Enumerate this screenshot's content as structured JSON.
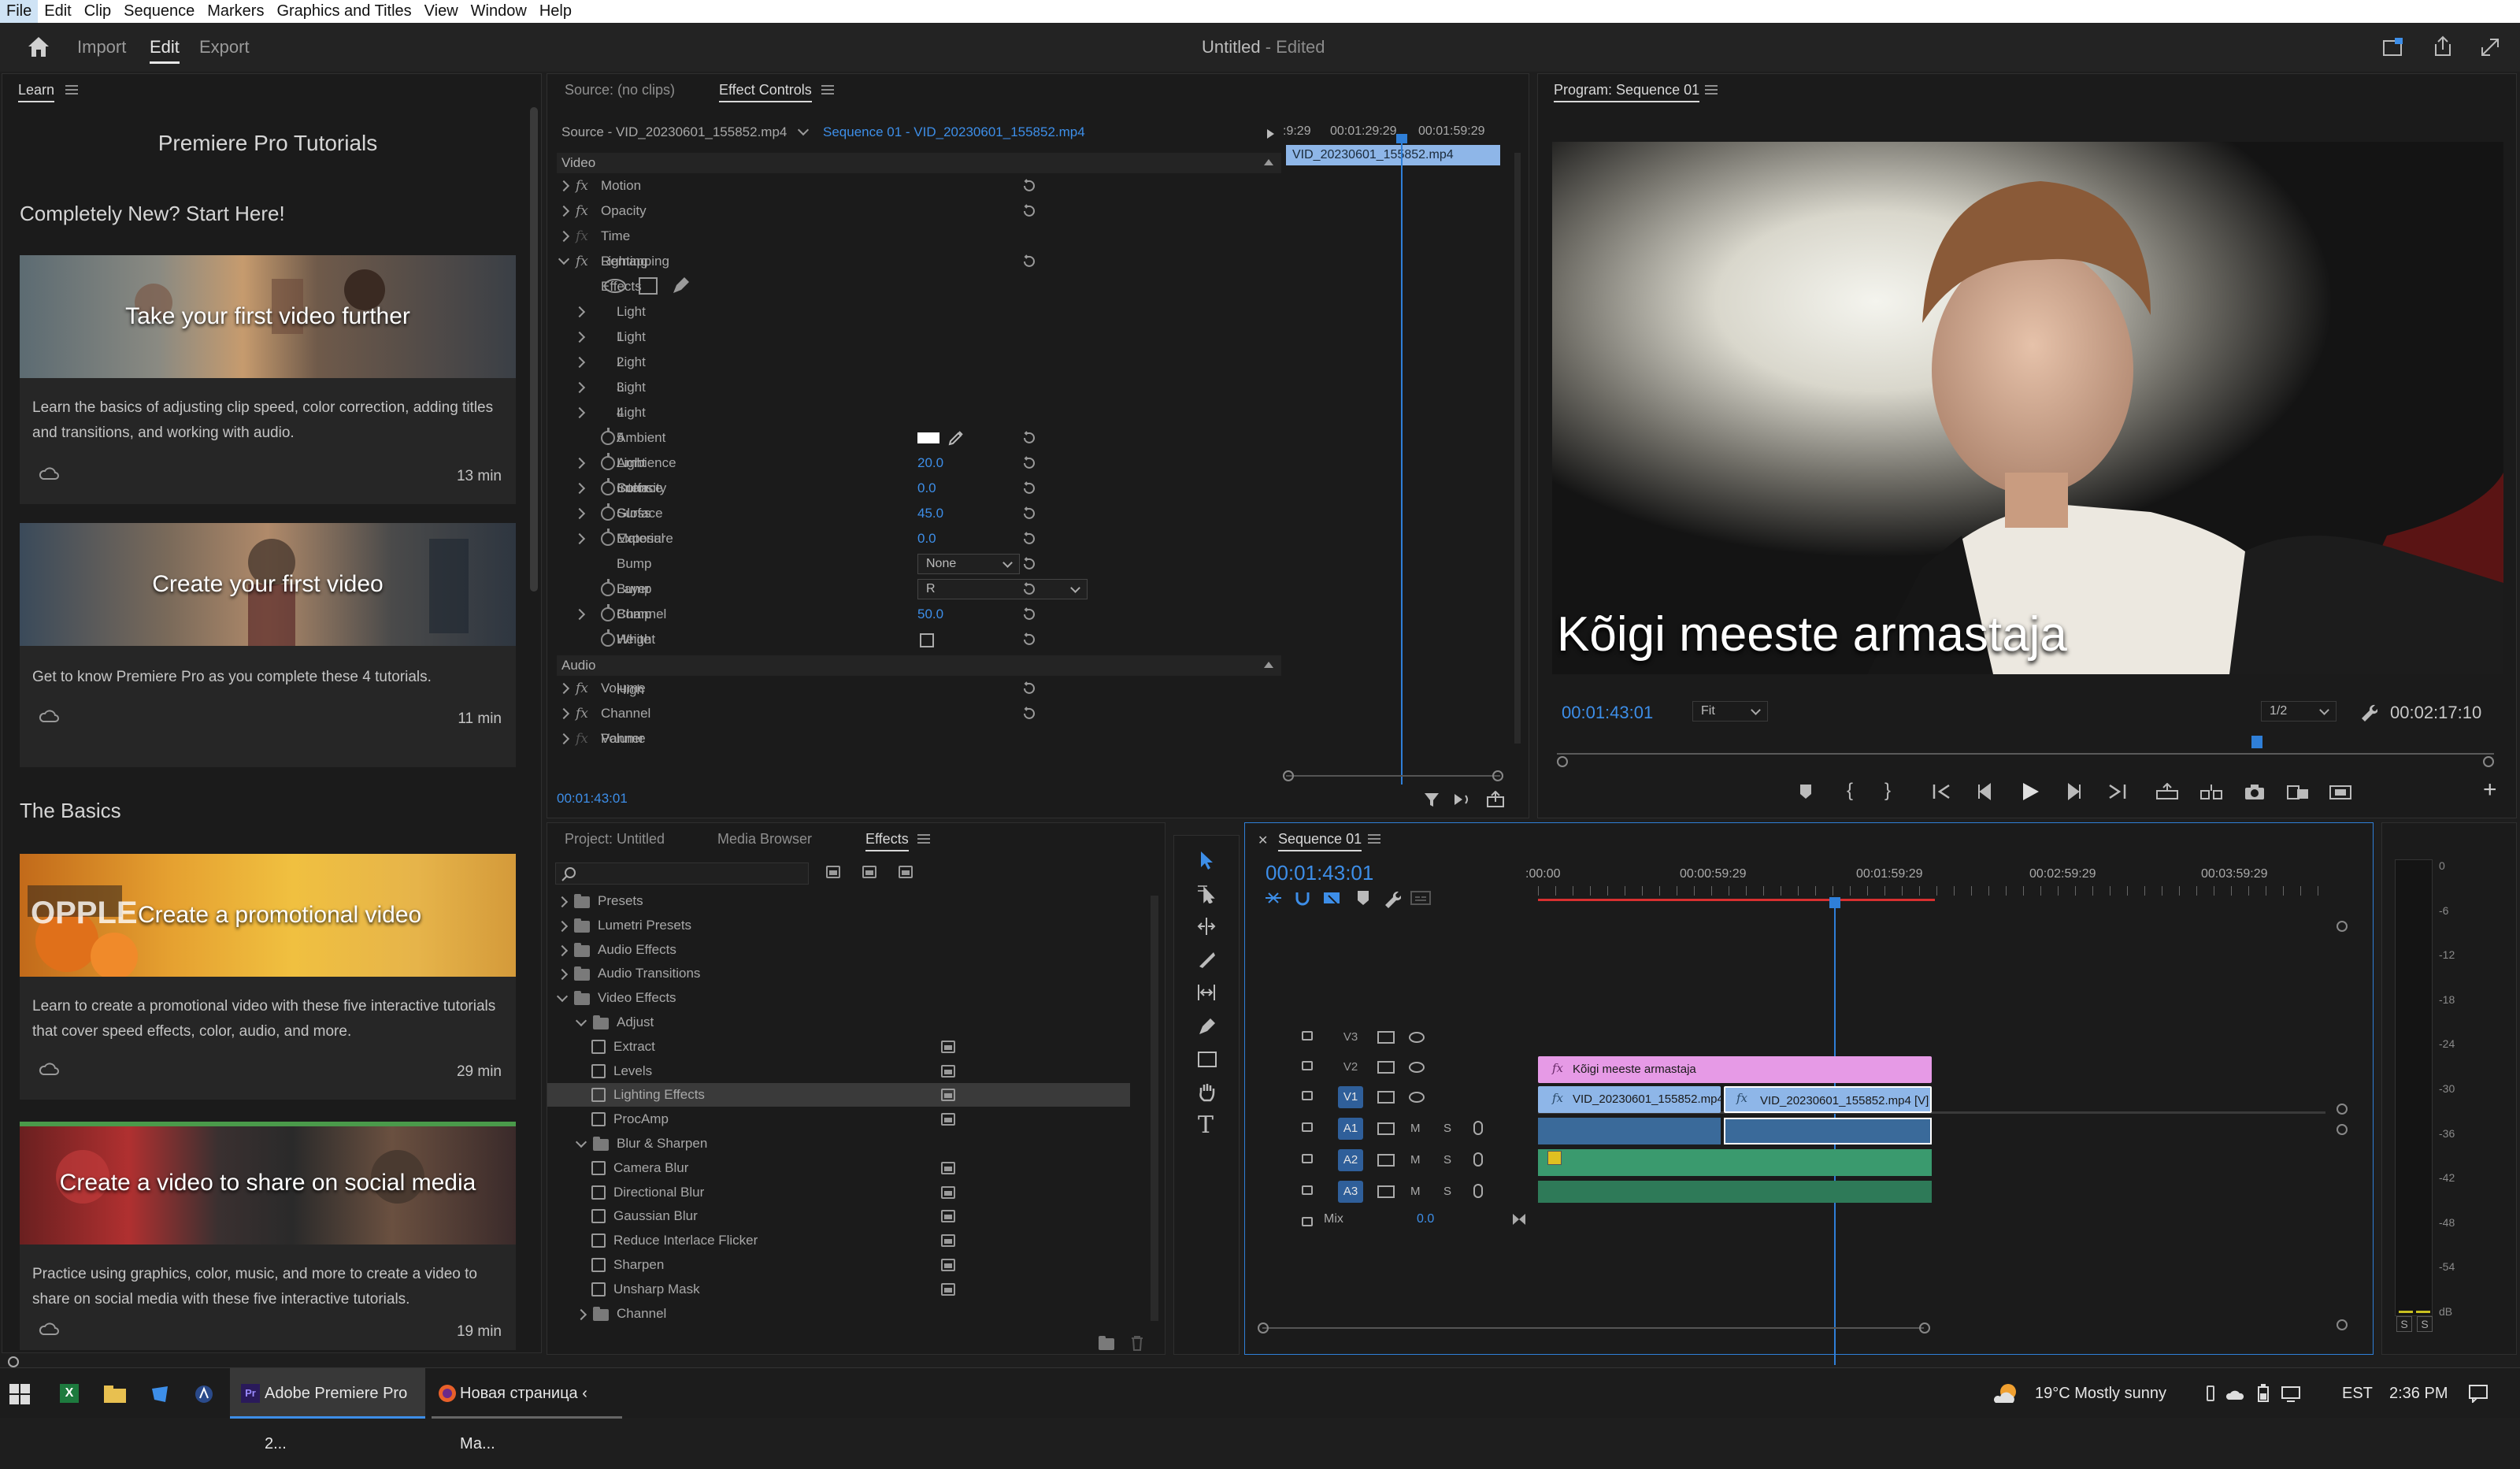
{
  "menubar": [
    "File",
    "Edit",
    "Clip",
    "Sequence",
    "Markers",
    "Graphics and Titles",
    "View",
    "Window",
    "Help"
  ],
  "header": {
    "tabs": [
      "Import",
      "Edit",
      "Export"
    ],
    "active_tab": "Edit",
    "doc_title": "Untitled",
    "doc_status": " - Edited"
  },
  "learn": {
    "tab": "Learn",
    "heading": "Premiere Pro Tutorials",
    "section1": "Completely New? Start Here!",
    "section2": "The Basics",
    "cards": [
      {
        "title": "Take your first video further",
        "desc": "Learn the basics of adjusting clip speed, color correction, adding titles and transitions, and working with audio.",
        "duration": "13 min"
      },
      {
        "title": "Create your first video",
        "desc": "Get to know Premiere Pro as you complete these 4 tutorials.",
        "duration": "11 min"
      },
      {
        "title": "Create a promotional video",
        "desc": "Learn to create a promotional video with these five interactive tutorials that cover speed effects, color, audio, and more.",
        "duration": "29 min"
      },
      {
        "title": "Create a video to share on social media",
        "desc": "Practice using graphics, color, music, and more to create a video to share on social media with these five interactive tutorials.",
        "duration": "19 min"
      }
    ]
  },
  "source_panel": {
    "tabs": [
      "Source: (no clips)",
      "Effect Controls"
    ],
    "active_tab": "Effect Controls",
    "source_clip": "Source - VID_20230601_155852.mp4",
    "sequence_clip": "Sequence 01 - VID_20230601_155852.mp4",
    "ruler": [
      ":9:29",
      "00:01:29:29",
      "00:01:59:29"
    ],
    "clip_bar": "VID_20230601_155852.mp4",
    "timecode": "00:01:43:01",
    "video_header": "Video",
    "audio_header": "Audio",
    "video_effects": [
      "Motion",
      "Opacity",
      "Time Remapping",
      "Lighting Effects"
    ],
    "lights": [
      "Light 1",
      "Light 2",
      "Light 3",
      "Light 4",
      "Light 5"
    ],
    "params": [
      {
        "name": "Ambient Light Color",
        "value": ""
      },
      {
        "name": "Ambience Intensity",
        "value": "20.0"
      },
      {
        "name": "Surface Gloss",
        "value": "0.0"
      },
      {
        "name": "Surface Material",
        "value": "45.0"
      },
      {
        "name": "Exposure",
        "value": "0.0"
      },
      {
        "name": "Bump Layer",
        "value": "None"
      },
      {
        "name": "Bump Channel",
        "value": "R"
      },
      {
        "name": "Bump Height",
        "value": "50.0"
      },
      {
        "name": "White Is High",
        "value": ""
      }
    ],
    "audio_effects": [
      "Volume",
      "Channel Volume",
      "Panner"
    ]
  },
  "program": {
    "title": "Program: Sequence 01",
    "subtitle": "Kõigi meeste armastaja",
    "timecode": "00:01:43:01",
    "fit": "Fit",
    "resolution": "1/2",
    "duration": "00:02:17:10",
    "playhead_fraction": 0.75
  },
  "project_panel": {
    "tabs": [
      "Project: Untitled",
      "Media Browser",
      "Effects"
    ],
    "active_tab": "Effects",
    "tree": [
      {
        "label": "Presets",
        "level": 0,
        "type": "folder",
        "open": false
      },
      {
        "label": "Lumetri Presets",
        "level": 0,
        "type": "folder",
        "open": false
      },
      {
        "label": "Audio Effects",
        "level": 0,
        "type": "folder",
        "open": false
      },
      {
        "label": "Audio Transitions",
        "level": 0,
        "type": "folder",
        "open": false
      },
      {
        "label": "Video Effects",
        "level": 0,
        "type": "folder",
        "open": true
      },
      {
        "label": "Adjust",
        "level": 1,
        "type": "folder",
        "open": true
      },
      {
        "label": "Extract",
        "level": 2,
        "type": "effect"
      },
      {
        "label": "Levels",
        "level": 2,
        "type": "effect"
      },
      {
        "label": "Lighting Effects",
        "level": 2,
        "type": "effect",
        "selected": true
      },
      {
        "label": "ProcAmp",
        "level": 2,
        "type": "effect"
      },
      {
        "label": "Blur & Sharpen",
        "level": 1,
        "type": "folder",
        "open": true
      },
      {
        "label": "Camera Blur",
        "level": 2,
        "type": "effect"
      },
      {
        "label": "Directional Blur",
        "level": 2,
        "type": "effect"
      },
      {
        "label": "Gaussian Blur",
        "level": 2,
        "type": "effect"
      },
      {
        "label": "Reduce Interlace Flicker",
        "level": 2,
        "type": "effect"
      },
      {
        "label": "Sharpen",
        "level": 2,
        "type": "effect"
      },
      {
        "label": "Unsharp Mask",
        "level": 2,
        "type": "effect"
      },
      {
        "label": "Channel",
        "level": 1,
        "type": "folder",
        "open": false
      }
    ]
  },
  "timeline": {
    "tab": "Sequence 01",
    "timecode": "00:01:43:01",
    "ruler": [
      ":00:00",
      "00:00:59:29",
      "00:01:59:29",
      "00:02:59:29",
      "00:03:59:29"
    ],
    "video_tracks": [
      "V3",
      "V2",
      "V1"
    ],
    "audio_tracks": [
      "A1",
      "A2",
      "A3"
    ],
    "track_buttons": {
      "mute": "M",
      "solo": "S"
    },
    "mix_label": "Mix",
    "mix_value": "0.0",
    "title_clip": "Kõigi meeste armastaja",
    "video_clip_1": "VID_20230601_155852.mp4",
    "video_clip_2": "VID_20230601_155852.mp4 [V]"
  },
  "meter": {
    "scale": [
      "0",
      "-6",
      "-12",
      "-18",
      "-24",
      "-30",
      "-36",
      "-42",
      "-48",
      "-54",
      "dB"
    ],
    "solo": [
      "S",
      "S"
    ]
  },
  "taskbar": {
    "items": [
      "Adobe Premiere Pro 2...",
      "Новая страница ‹ Ма..."
    ],
    "weather": "19°C  Mostly sunny",
    "lang": "EST",
    "time": "2:36 PM"
  },
  "colors": {
    "accent_blue": "#3d8ee8",
    "title_clip": "#e69ae6",
    "video_clip": "#8eb6e8",
    "audio_clip": "#3a9a6e",
    "playhead": "#2f7fd8"
  },
  "icons": [
    "home-icon",
    "share-icon",
    "export-icon",
    "fullscreen-icon",
    "search-icon",
    "play-icon",
    "wrench-icon",
    "selection-tool-icon",
    "track-select-icon",
    "ripple-edit-icon",
    "razor-icon",
    "slip-icon",
    "pen-icon",
    "rectangle-icon",
    "hand-icon",
    "type-icon"
  ]
}
